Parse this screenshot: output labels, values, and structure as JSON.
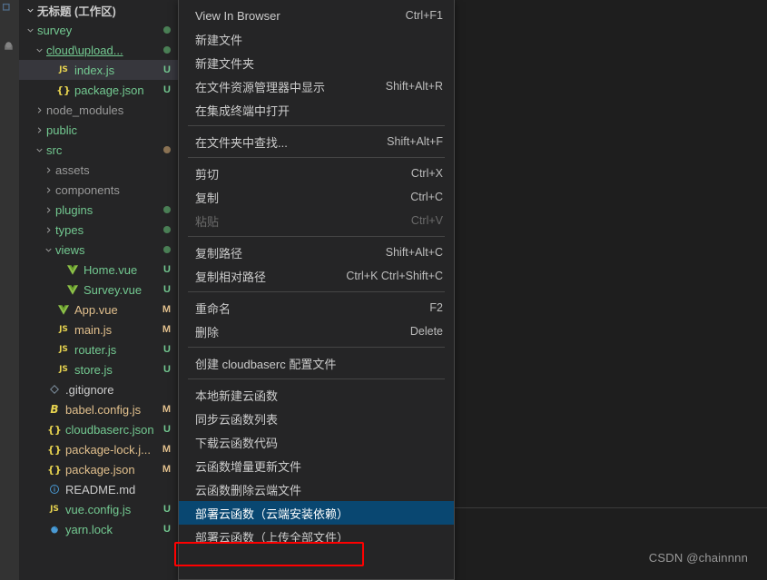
{
  "window": {
    "title": "无标题 (工作区)",
    "watermark": "CSDN @chainnnn"
  },
  "activitybar": {
    "icons": [
      "explorer-icon",
      "search-icon",
      "source-control-icon"
    ]
  },
  "explorer": {
    "root_label": "无标题 (工作区)",
    "items": [
      {
        "label": "survey",
        "indent": 1,
        "kind": "folder",
        "twisty": "down",
        "badge": "",
        "dot": "#4a7f55"
      },
      {
        "label": "cloud\\upload...",
        "indent": 2,
        "kind": "folder",
        "twisty": "down",
        "badge": "",
        "dot": "#4a7f55",
        "underline": true
      },
      {
        "label": "index.js",
        "indent": 3,
        "kind": "js",
        "twisty": "",
        "badge": "U",
        "badge_color": "#73c991",
        "selected": true
      },
      {
        "label": "package.json",
        "indent": 3,
        "kind": "json",
        "twisty": "",
        "badge": "U",
        "badge_color": "#73c991"
      },
      {
        "label": "node_modules",
        "indent": 2,
        "kind": "folder-muted",
        "twisty": "right",
        "badge": ""
      },
      {
        "label": "public",
        "indent": 2,
        "kind": "folder",
        "twisty": "right",
        "badge": ""
      },
      {
        "label": "src",
        "indent": 2,
        "kind": "folder",
        "twisty": "down",
        "badge": "",
        "dot": "#8a7253"
      },
      {
        "label": "assets",
        "indent": 3,
        "kind": "folder-muted",
        "twisty": "right",
        "badge": ""
      },
      {
        "label": "components",
        "indent": 3,
        "kind": "folder-muted",
        "twisty": "right",
        "badge": ""
      },
      {
        "label": "plugins",
        "indent": 3,
        "kind": "folder",
        "twisty": "right",
        "badge": "",
        "dot": "#4a7f55"
      },
      {
        "label": "types",
        "indent": 3,
        "kind": "folder",
        "twisty": "right",
        "badge": "",
        "dot": "#4a7f55"
      },
      {
        "label": "views",
        "indent": 3,
        "kind": "folder",
        "twisty": "down",
        "badge": "",
        "dot": "#4a7f55"
      },
      {
        "label": "Home.vue",
        "indent": 4,
        "kind": "vue",
        "twisty": "",
        "badge": "U",
        "badge_color": "#73c991"
      },
      {
        "label": "Survey.vue",
        "indent": 4,
        "kind": "vue",
        "twisty": "",
        "badge": "U",
        "badge_color": "#73c991"
      },
      {
        "label": "App.vue",
        "indent": 3,
        "kind": "vue",
        "twisty": "",
        "badge": "M",
        "badge_color": "#e2c08d",
        "mod": true
      },
      {
        "label": "main.js",
        "indent": 3,
        "kind": "js",
        "twisty": "",
        "badge": "M",
        "badge_color": "#e2c08d",
        "mod": true
      },
      {
        "label": "router.js",
        "indent": 3,
        "kind": "js",
        "twisty": "",
        "badge": "U",
        "badge_color": "#73c991"
      },
      {
        "label": "store.js",
        "indent": 3,
        "kind": "js",
        "twisty": "",
        "badge": "U",
        "badge_color": "#73c991"
      },
      {
        "label": ".gitignore",
        "indent": 2,
        "kind": "git",
        "twisty": "",
        "badge": ""
      },
      {
        "label": "babel.config.js",
        "indent": 2,
        "kind": "babel",
        "twisty": "",
        "badge": "M",
        "badge_color": "#e2c08d",
        "mod": true
      },
      {
        "label": "cloudbaserc.json",
        "indent": 2,
        "kind": "json",
        "twisty": "",
        "badge": "U",
        "badge_color": "#73c991"
      },
      {
        "label": "package-lock.j...",
        "indent": 2,
        "kind": "json",
        "twisty": "",
        "badge": "M",
        "badge_color": "#e2c08d",
        "mod": true
      },
      {
        "label": "package.json",
        "indent": 2,
        "kind": "json",
        "twisty": "",
        "badge": "M",
        "badge_color": "#e2c08d",
        "mod": true
      },
      {
        "label": "README.md",
        "indent": 2,
        "kind": "info",
        "twisty": "",
        "badge": ""
      },
      {
        "label": "vue.config.js",
        "indent": 2,
        "kind": "js",
        "twisty": "",
        "badge": "U",
        "badge_color": "#73c991"
      },
      {
        "label": "yarn.lock",
        "indent": 2,
        "kind": "yarn",
        "twisty": "",
        "badge": "U",
        "badge_color": "#73c991"
      }
    ]
  },
  "context_menu": {
    "items": [
      {
        "type": "item",
        "label": "View In Browser",
        "key": "Ctrl+F1"
      },
      {
        "type": "item",
        "label": "新建文件",
        "key": ""
      },
      {
        "type": "item",
        "label": "新建文件夹",
        "key": ""
      },
      {
        "type": "item",
        "label": "在文件资源管理器中显示",
        "key": "Shift+Alt+R"
      },
      {
        "type": "item",
        "label": "在集成终端中打开",
        "key": ""
      },
      {
        "type": "sep"
      },
      {
        "type": "item",
        "label": "在文件夹中查找...",
        "key": "Shift+Alt+F"
      },
      {
        "type": "sep"
      },
      {
        "type": "item",
        "label": "剪切",
        "key": "Ctrl+X"
      },
      {
        "type": "item",
        "label": "复制",
        "key": "Ctrl+C"
      },
      {
        "type": "item",
        "label": "粘贴",
        "key": "Ctrl+V",
        "disabled": true
      },
      {
        "type": "sep"
      },
      {
        "type": "item",
        "label": "复制路径",
        "key": "Shift+Alt+C"
      },
      {
        "type": "item",
        "label": "复制相对路径",
        "key": "Ctrl+K Ctrl+Shift+C"
      },
      {
        "type": "sep"
      },
      {
        "type": "item",
        "label": "重命名",
        "key": "F2"
      },
      {
        "type": "item",
        "label": "删除",
        "key": "Delete"
      },
      {
        "type": "sep"
      },
      {
        "type": "item",
        "label": "创建 cloudbaserc 配置文件",
        "key": ""
      },
      {
        "type": "sep"
      },
      {
        "type": "item",
        "label": "本地新建云函数",
        "key": ""
      },
      {
        "type": "item",
        "label": "同步云函数列表",
        "key": ""
      },
      {
        "type": "item",
        "label": "下载云函数代码",
        "key": ""
      },
      {
        "type": "item",
        "label": "云函数增量更新文件",
        "key": ""
      },
      {
        "type": "item",
        "label": "云函数删除云端文件",
        "key": ""
      },
      {
        "type": "item",
        "label": "部署云函数（云端安装依赖）",
        "key": "",
        "highlight": true,
        "annotated": true
      },
      {
        "type": "item",
        "label": "部署云函数（上传全部文件）",
        "key": ""
      }
    ]
  },
  "annotation": {
    "color": "#ff0000",
    "target_label": "部署云函数（云端安装依赖）"
  }
}
